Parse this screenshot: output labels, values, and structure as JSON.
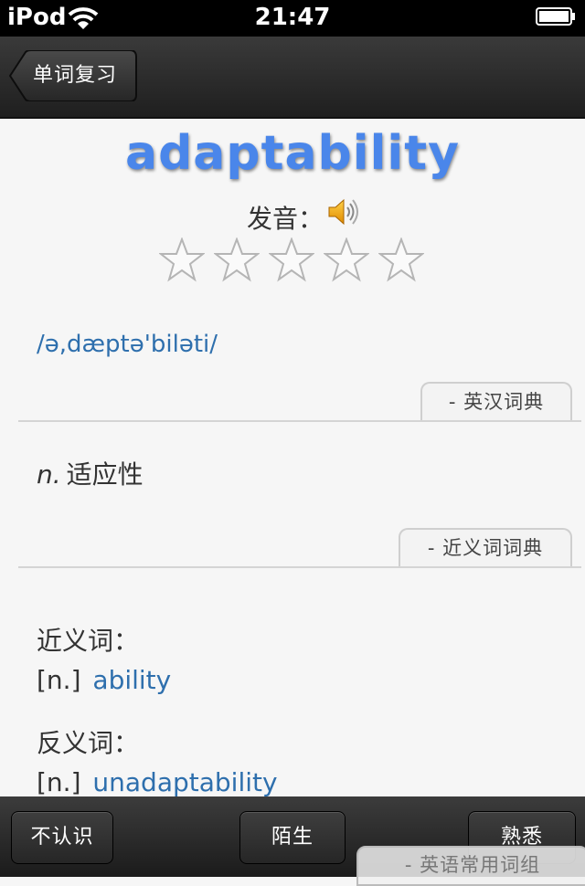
{
  "status": {
    "carrier": "iPod",
    "time": "21:47"
  },
  "nav": {
    "back_label": "单词复习"
  },
  "word": {
    "title": "adaptability",
    "pronounce_label": "发音：",
    "rating": 0,
    "rating_max": 5,
    "phonetic": "/ə,dæptə'biləti/"
  },
  "tabs": {
    "en_zh": "- 英汉词典",
    "synonym": "- 近义词词典",
    "common_phrase": "- 英语常用词组"
  },
  "definition": {
    "pos": "n.",
    "text": "适应性"
  },
  "synonyms": {
    "synonym_label": "近义词：",
    "synonym_pos": "[n.]",
    "synonym_word": "ability",
    "antonym_label": "反义词：",
    "antonym_pos": "[n.]",
    "antonym_word": "unadaptability"
  },
  "toolbar": {
    "unknown": "不认识",
    "unfamiliar": "陌生",
    "familiar": "熟悉"
  },
  "colors": {
    "word": "#4a86ea",
    "link": "#2e6fad",
    "bar": "#2a2a2a"
  }
}
